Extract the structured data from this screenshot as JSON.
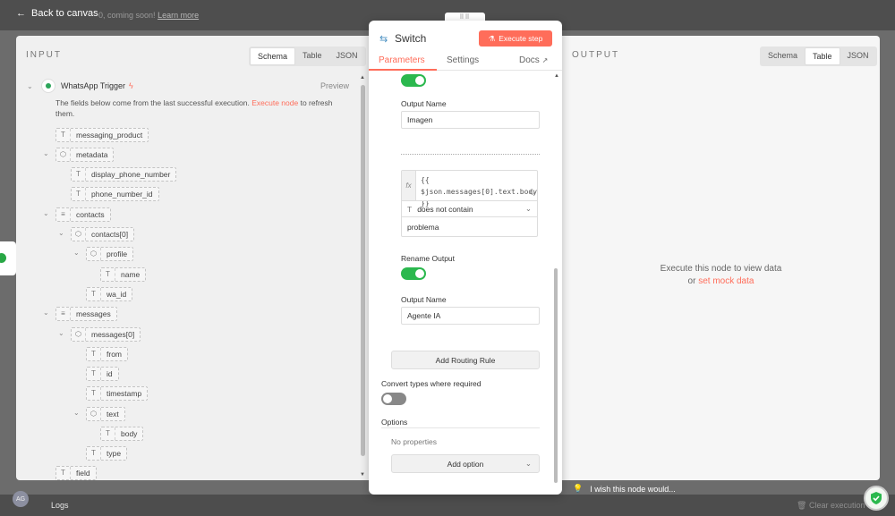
{
  "topbar": {
    "back_label": "Back to canvas",
    "notice_text": "0, coming soon!",
    "learn_more": "Learn more"
  },
  "input_panel": {
    "title": "INPUT",
    "view_tabs": [
      "Schema",
      "Table",
      "JSON"
    ],
    "active_tab": "Schema",
    "trigger_name": "WhatsApp Trigger",
    "preview_label": "Preview",
    "info_prefix": "The fields below come from the last successful execution.",
    "info_link": "Execute node",
    "info_suffix": "to refresh them.",
    "fields": {
      "messaging_product": "messaging_product",
      "metadata": "metadata",
      "display_phone_number": "display_phone_number",
      "phone_number_id": "phone_number_id",
      "contacts": "contacts",
      "contacts0": "contacts[0]",
      "profile": "profile",
      "name": "name",
      "wa_id": "wa_id",
      "messages": "messages",
      "messages0": "messages[0]",
      "from": "from",
      "id": "id",
      "timestamp": "timestamp",
      "text": "text",
      "body": "body",
      "type": "type",
      "field": "field"
    }
  },
  "node": {
    "drag_handle": "⠿⠿",
    "title": "Switch",
    "execute_label": "Execute step",
    "tabs": {
      "parameters": "Parameters",
      "settings": "Settings",
      "docs": "Docs"
    },
    "params": {
      "output_name_label": "Output Name",
      "output_name_1": "Imagen",
      "fx": "fx",
      "expression": "{{ $json.messages[0].text.body }}",
      "operator": "does not contain",
      "value": "problema",
      "rename_output_label": "Rename Output",
      "output_name_2": "Agente IA",
      "add_rule": "Add Routing Rule",
      "convert_types_label": "Convert types where required",
      "options_label": "Options",
      "no_properties": "No properties",
      "add_option": "Add option"
    }
  },
  "output_panel": {
    "title": "OUTPUT",
    "view_tabs": [
      "Schema",
      "Table",
      "JSON"
    ],
    "active_tab": "Table",
    "empty_message": "Execute this node to view data",
    "or": "or",
    "mock_link": "set mock data"
  },
  "bottom": {
    "avatar": "AG",
    "logs": "Logs",
    "clear_execution": "Clear execution",
    "wish": "I wish this node would..."
  },
  "colors": {
    "accent": "#ff6d5a",
    "toggle_on": "#2bb84e",
    "switch_icon": "#4a90c2"
  }
}
